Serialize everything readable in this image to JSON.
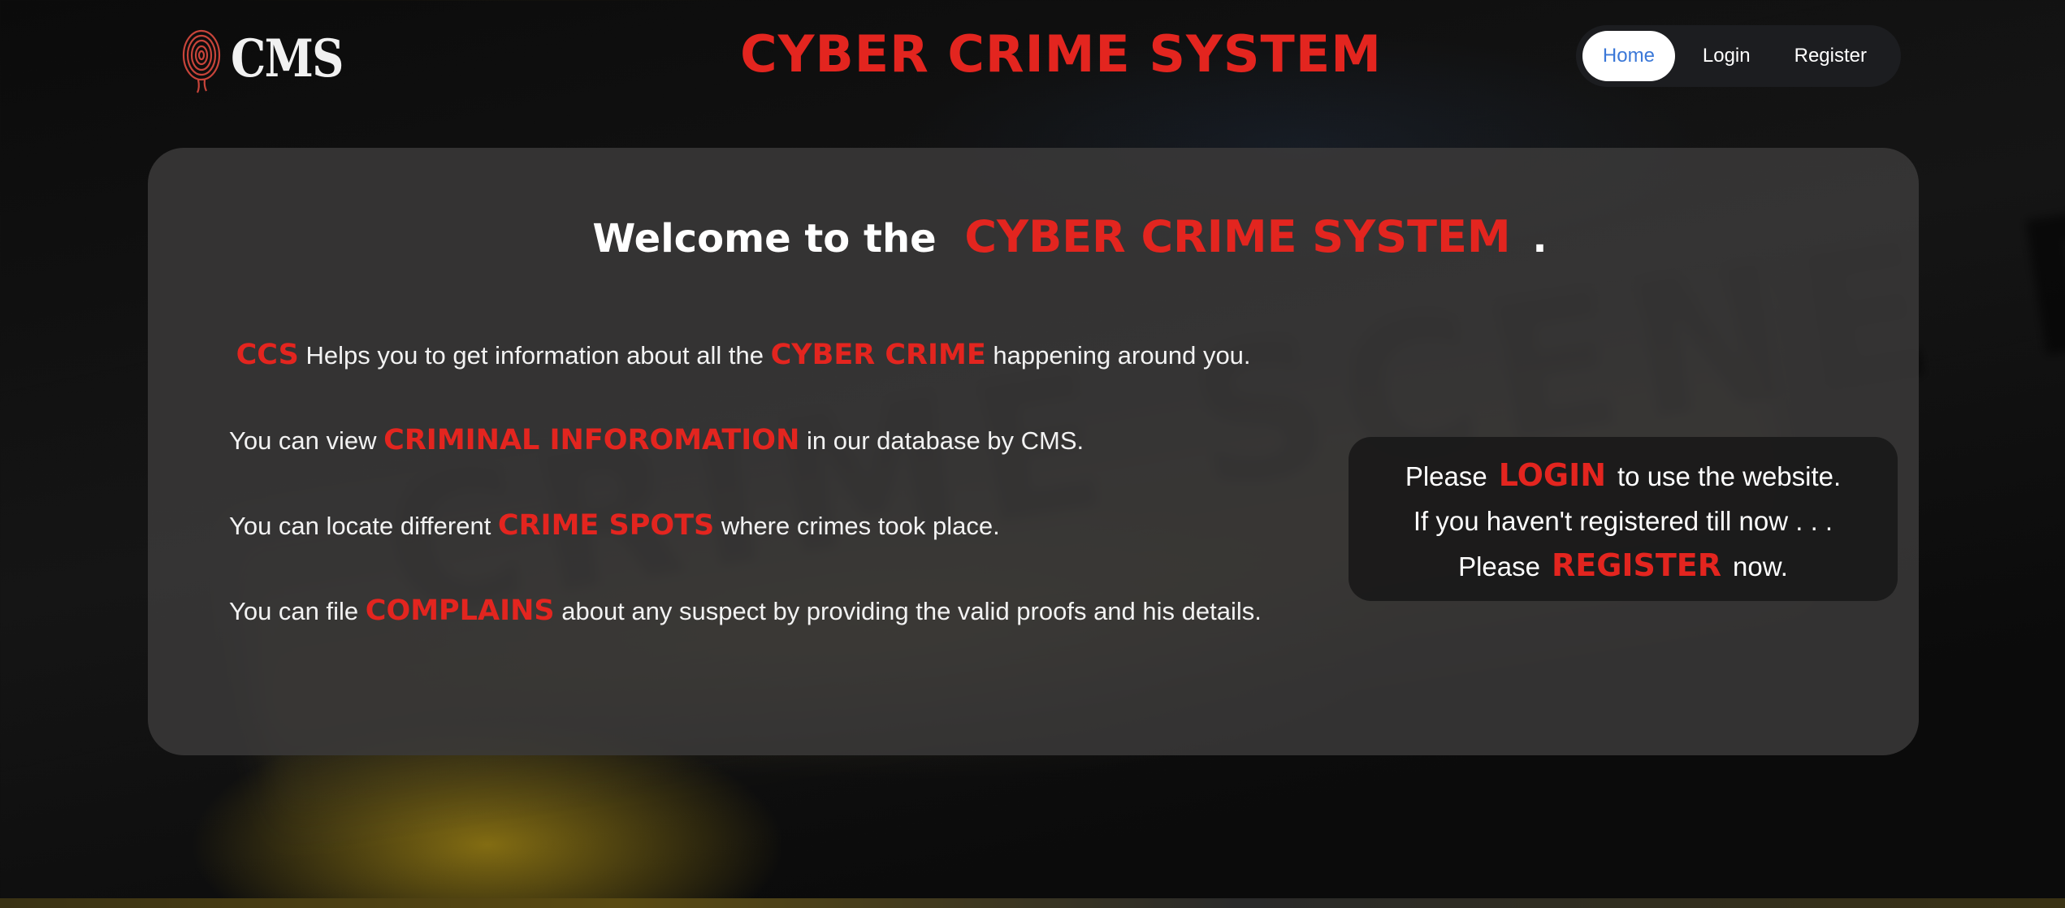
{
  "header": {
    "logo_text": "CMS",
    "site_title": "CYBER CRIME SYSTEM",
    "nav": [
      {
        "label": "Home",
        "active": true
      },
      {
        "label": "Login",
        "active": false
      },
      {
        "label": "Register",
        "active": false
      }
    ]
  },
  "background": {
    "tape_text": "CRIME SCENE DO NOT"
  },
  "main": {
    "welcome": {
      "prefix": "Welcome to the",
      "highlight": "CYBER CRIME SYSTEM",
      "suffix": "."
    },
    "paragraphs": [
      {
        "lead": "",
        "highlight": "CCS",
        "middle": " Helps you to get information about all the ",
        "highlight2": "CYBER CRIME",
        "tail": " happening around you."
      },
      {
        "lead": "You can view ",
        "highlight": "CRIMINAL INFOROMATION",
        "tail": " in our database by CMS."
      },
      {
        "lead": "You can locate different ",
        "highlight": "CRIME SPOTS",
        "tail": " where crimes took place."
      },
      {
        "lead": "You can file ",
        "highlight": "COMPLAINS",
        "tail": " about any suspect by providing the valid proofs and his details."
      }
    ],
    "login_prompt": {
      "line1_prefix": "Please",
      "line1_link": "LOGIN",
      "line1_suffix": "to use the website.",
      "line2": "If you haven't registered till now . . .",
      "line3_prefix": "Please",
      "line3_link": "REGISTER",
      "line3_suffix": "now."
    }
  },
  "colors": {
    "accent_red": "#e3251f",
    "nav_active_text": "#3b78d8",
    "card_bg": "#3a3939"
  }
}
